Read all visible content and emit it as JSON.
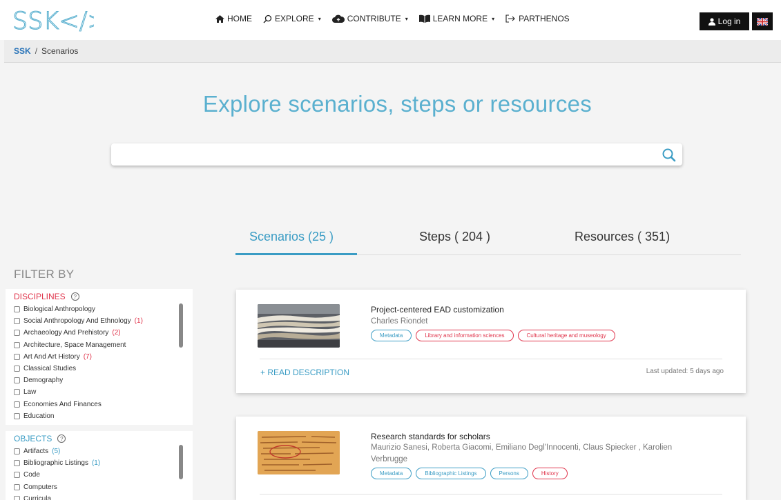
{
  "header": {
    "logo_text": "SSK</>",
    "nav": [
      {
        "label": "HOME",
        "icon": "home-icon"
      },
      {
        "label": "EXPLORE",
        "icon": "search-icon",
        "caret": "▾"
      },
      {
        "label": "CONTRIBUTE",
        "icon": "cloud-upload-icon",
        "caret": "▾"
      },
      {
        "label": "LEARN MORE",
        "icon": "book-icon",
        "caret": "▾"
      },
      {
        "label": "PARTHENOS",
        "icon": "external-link-icon"
      }
    ],
    "login_label": "Log in",
    "language_icon": "uk-flag-icon"
  },
  "breadcrumb": {
    "root": "SSK",
    "separator": "/",
    "current": "Scenarios"
  },
  "hero": {
    "title": "Explore scenarios, steps or resources",
    "search_placeholder": ""
  },
  "tabs": [
    {
      "label": "Scenarios (25 )",
      "active": true
    },
    {
      "label": "Steps ( 204 )",
      "active": false
    },
    {
      "label": "Resources ( 351)",
      "active": false
    }
  ],
  "filter": {
    "title": "FILTER BY",
    "disciplines": {
      "label": "DISCIPLINES",
      "help": "?",
      "items": [
        {
          "label": "Biological Anthropology",
          "count": ""
        },
        {
          "label": "Social Anthropology And Ethnology",
          "count": "(1)"
        },
        {
          "label": "Archaeology And Prehistory",
          "count": "(2)"
        },
        {
          "label": "Architecture, Space Management",
          "count": ""
        },
        {
          "label": "Art And Art History",
          "count": "(7)"
        },
        {
          "label": "Classical Studies",
          "count": ""
        },
        {
          "label": "Demography",
          "count": ""
        },
        {
          "label": "Law",
          "count": ""
        },
        {
          "label": "Economies And Finances",
          "count": ""
        },
        {
          "label": "Education",
          "count": ""
        }
      ]
    },
    "objects": {
      "label": "OBJECTS",
      "help": "?",
      "items": [
        {
          "label": "Artifacts",
          "count": "(5)"
        },
        {
          "label": "Bibliographic Listings",
          "count": "(1)"
        },
        {
          "label": "Code",
          "count": ""
        },
        {
          "label": "Computers",
          "count": ""
        },
        {
          "label": "Curricula",
          "count": ""
        }
      ]
    }
  },
  "scenarios": [
    {
      "title": "Project-centered EAD customization",
      "authors": "Charles Riondet",
      "tags": [
        {
          "label": "Metadata",
          "color": "blue"
        },
        {
          "label": "Library and information sciences",
          "color": "red"
        },
        {
          "label": "Cultural heritage and museology",
          "color": "red"
        }
      ],
      "read_label": "+ READ DESCRIPTION",
      "updated": "Last updated: 5 days ago"
    },
    {
      "title": "Research standards for scholars",
      "authors": "Maurizio Sanesi, Roberta Giacomi, Emiliano Degl'Innocenti, Claus Spiecker , Karolien Verbrugge",
      "tags": [
        {
          "label": "Metadata",
          "color": "blue"
        },
        {
          "label": "Bibliographic Listings",
          "color": "blue"
        },
        {
          "label": "Persons",
          "color": "blue"
        },
        {
          "label": "History",
          "color": "red"
        }
      ]
    }
  ],
  "colors": {
    "accent": "#3a9cc4",
    "hero": "#5ab0cf",
    "tag_red": "#e0344b",
    "dark": "#111111"
  }
}
